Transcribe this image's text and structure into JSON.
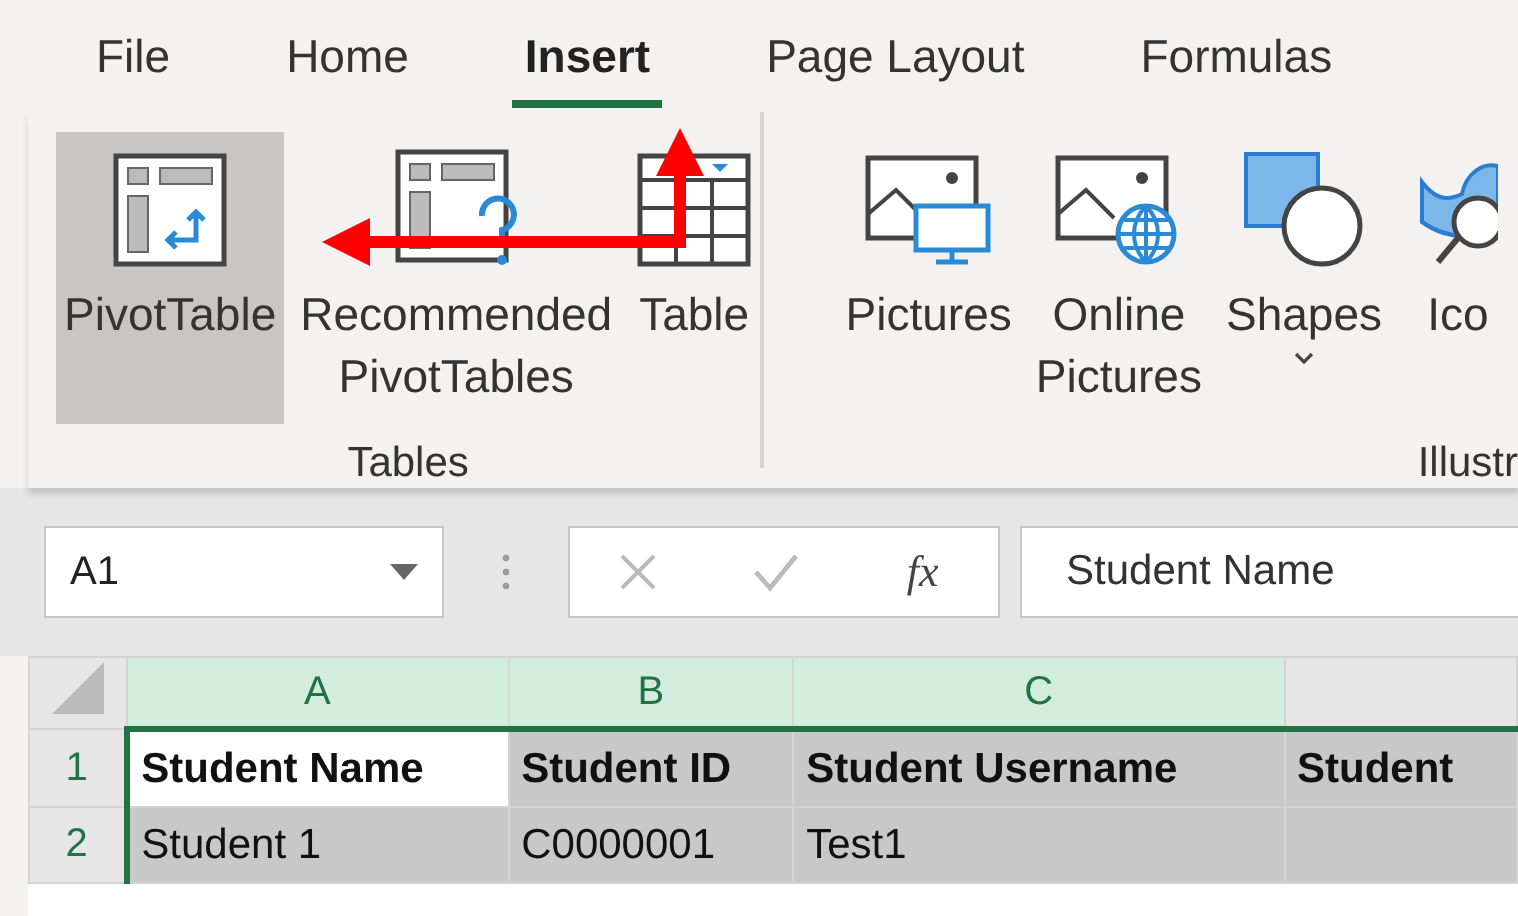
{
  "tabs": [
    {
      "label": "File",
      "selected": false
    },
    {
      "label": "Home",
      "selected": false
    },
    {
      "label": "Insert",
      "selected": true
    },
    {
      "label": "Page Layout",
      "selected": false
    },
    {
      "label": "Formulas",
      "selected": false
    }
  ],
  "ribbon": {
    "groups": [
      {
        "label": "Tables",
        "buttons": [
          {
            "lines": [
              "PivotTable"
            ],
            "kind": "pivot",
            "selected": true
          },
          {
            "lines": [
              "Recommended",
              "PivotTables"
            ],
            "kind": "recommended",
            "selected": false
          },
          {
            "lines": [
              "Table"
            ],
            "kind": "table",
            "selected": false
          }
        ]
      },
      {
        "label": "Illustr",
        "buttons": [
          {
            "lines": [
              "Pictures"
            ],
            "kind": "pictures",
            "selected": false
          },
          {
            "lines": [
              "Online",
              "Pictures"
            ],
            "kind": "online",
            "selected": false
          },
          {
            "lines": [
              "Shapes"
            ],
            "kind": "shapes",
            "selected": false,
            "dropdown": true
          },
          {
            "lines": [
              "Ico"
            ],
            "kind": "icons",
            "selected": false
          }
        ]
      }
    ]
  },
  "formula_bar": {
    "name_box": "A1",
    "function_label": "fx",
    "value": "Student Name"
  },
  "grid": {
    "columns": [
      {
        "label": "A",
        "selected": true
      },
      {
        "label": "B",
        "selected": true
      },
      {
        "label": "C",
        "selected": true
      },
      {
        "selected": false
      }
    ],
    "rows": [
      {
        "header": "1",
        "bold": true,
        "cells": [
          {
            "text": "Student Name",
            "active": true
          },
          {
            "text": "Student ID",
            "active": false
          },
          {
            "text": "Student Username",
            "active": false
          },
          {
            "text": "Student",
            "active": false
          }
        ]
      },
      {
        "header": "2",
        "bold": false,
        "cells": [
          {
            "text": "Student 1",
            "active": false
          },
          {
            "text": "C0000001",
            "active": false
          },
          {
            "text": "Test1",
            "active": false
          }
        ]
      }
    ]
  }
}
